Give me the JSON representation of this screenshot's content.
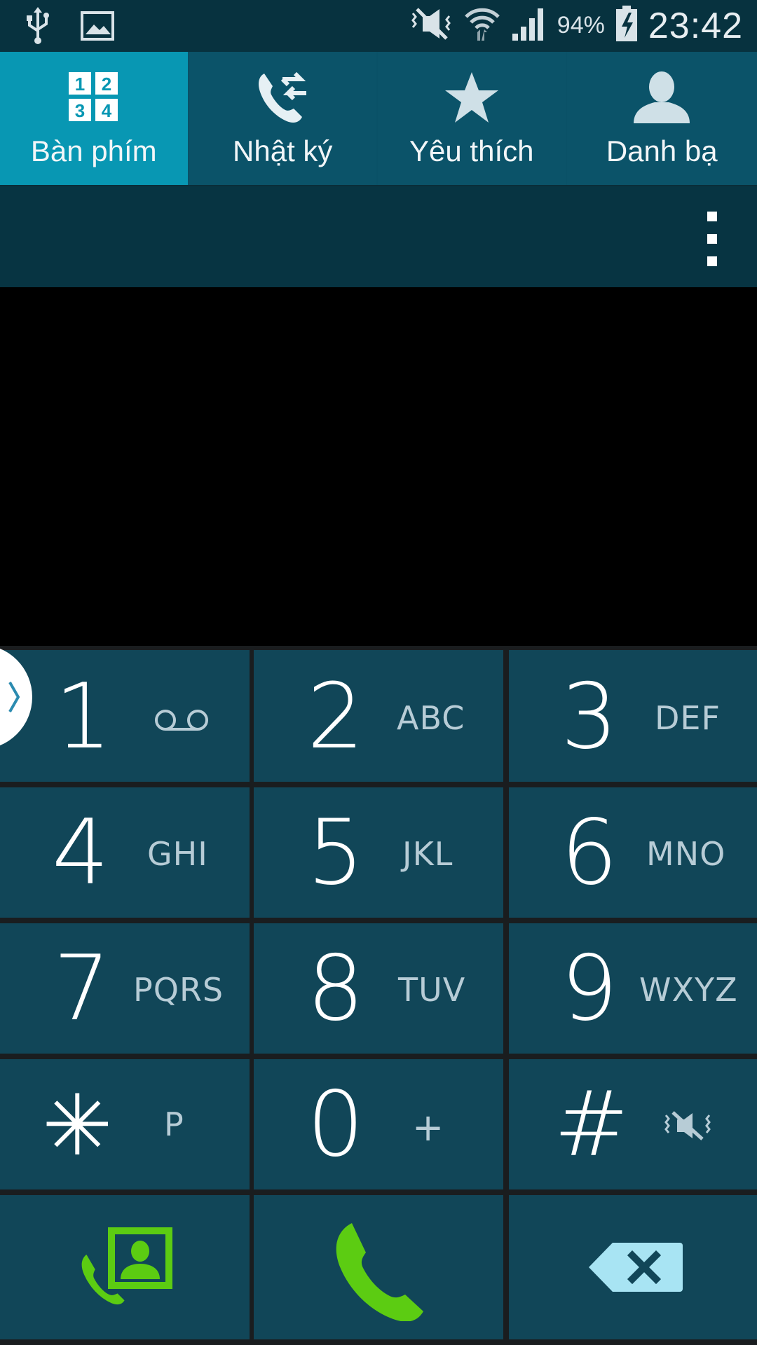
{
  "status_bar": {
    "battery_percent": "94%",
    "time": "23:42",
    "icons": [
      "usb-icon",
      "gallery-icon",
      "mute-icon",
      "wifi-icon",
      "signal-icon",
      "battery-charging-icon"
    ]
  },
  "tabs": [
    {
      "label": "Bàn phím",
      "icon": "keypad-icon",
      "active": true
    },
    {
      "label": "Nhật ký",
      "icon": "call-log-icon",
      "active": false
    },
    {
      "label": "Yêu thích",
      "icon": "star-icon",
      "active": false
    },
    {
      "label": "Danh bạ",
      "icon": "contact-icon",
      "active": false
    }
  ],
  "keypad": {
    "keys": [
      {
        "digit": "1",
        "letters": ""
      },
      {
        "digit": "2",
        "letters": "ABC"
      },
      {
        "digit": "3",
        "letters": "DEF"
      },
      {
        "digit": "4",
        "letters": "GHI"
      },
      {
        "digit": "5",
        "letters": "JKL"
      },
      {
        "digit": "6",
        "letters": "MNO"
      },
      {
        "digit": "7",
        "letters": "PQRS"
      },
      {
        "digit": "8",
        "letters": "TUV"
      },
      {
        "digit": "9",
        "letters": "WXYZ"
      },
      {
        "digit": "✳",
        "letters": "P"
      },
      {
        "digit": "0",
        "letters": "+"
      },
      {
        "digit": "#",
        "letters": ""
      }
    ],
    "bottom_actions": [
      "add-contact-icon",
      "call-icon",
      "backspace-icon"
    ]
  },
  "colors": {
    "active_tab": "#0897b3",
    "tab": "#0b5369",
    "key": "#114658",
    "call_green": "#5ccc12",
    "backspace": "#a8e4f3"
  }
}
